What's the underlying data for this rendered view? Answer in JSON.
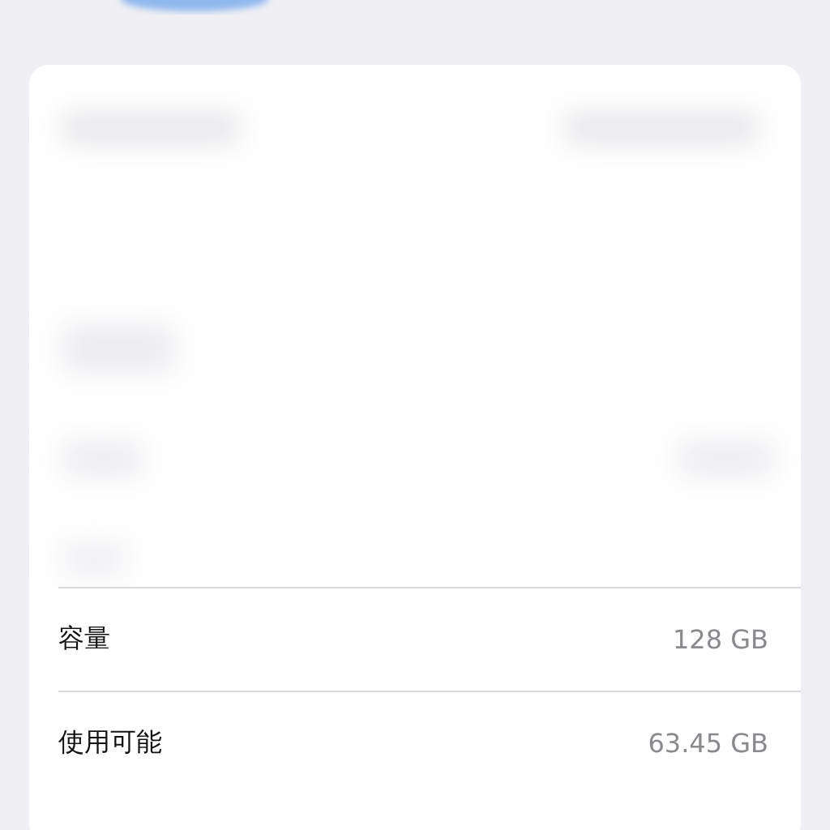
{
  "rows": [
    {
      "label": "容量",
      "value": "128 GB"
    },
    {
      "label": "使用可能",
      "value": "63.45 GB"
    }
  ]
}
